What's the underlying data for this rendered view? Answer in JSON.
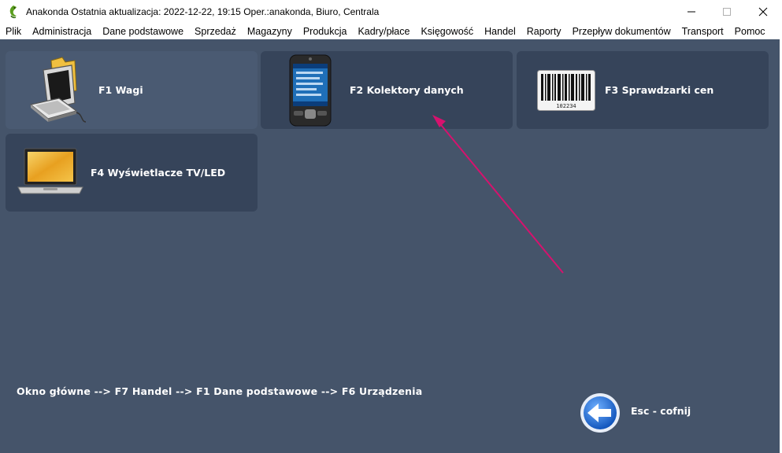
{
  "window": {
    "title": "Anakonda Ostatnia aktualizacja: 2022-12-22, 19:15 Oper.:anakonda, Biuro, Centrala"
  },
  "menu": [
    {
      "label": "Plik"
    },
    {
      "label": "Administracja"
    },
    {
      "label": "Dane podstawowe"
    },
    {
      "label": "Sprzedaż"
    },
    {
      "label": "Magazyny"
    },
    {
      "label": "Produkcja"
    },
    {
      "label": "Kadry/płace"
    },
    {
      "label": "Księgowość"
    },
    {
      "label": "Handel"
    },
    {
      "label": "Raporty"
    },
    {
      "label": "Przepływ dokumentów"
    },
    {
      "label": "Transport"
    },
    {
      "label": "Pomoc"
    }
  ],
  "tiles": [
    {
      "label": "F1  Wagi",
      "icon": "computer-icon"
    },
    {
      "label": "F2  Kolektory danych",
      "icon": "pda-device-icon"
    },
    {
      "label": "F3  Sprawdzarki cen",
      "icon": "barcode-icon",
      "barcode_number": "102234"
    },
    {
      "label": "F4  Wyświetlacze TV/LED",
      "icon": "laptop-icon"
    }
  ],
  "breadcrumb": "Okno główne  -->  F7  Handel  -->  F1  Dane podstawowe  -->  F6  Urządzenia",
  "back": {
    "label": "Esc - cofnij",
    "icon": "back-arrow-icon"
  },
  "colors": {
    "background": "#45546a",
    "tile": "#36445a",
    "tile_hover": "#4a5a72",
    "annotation_arrow": "#d6126e"
  }
}
